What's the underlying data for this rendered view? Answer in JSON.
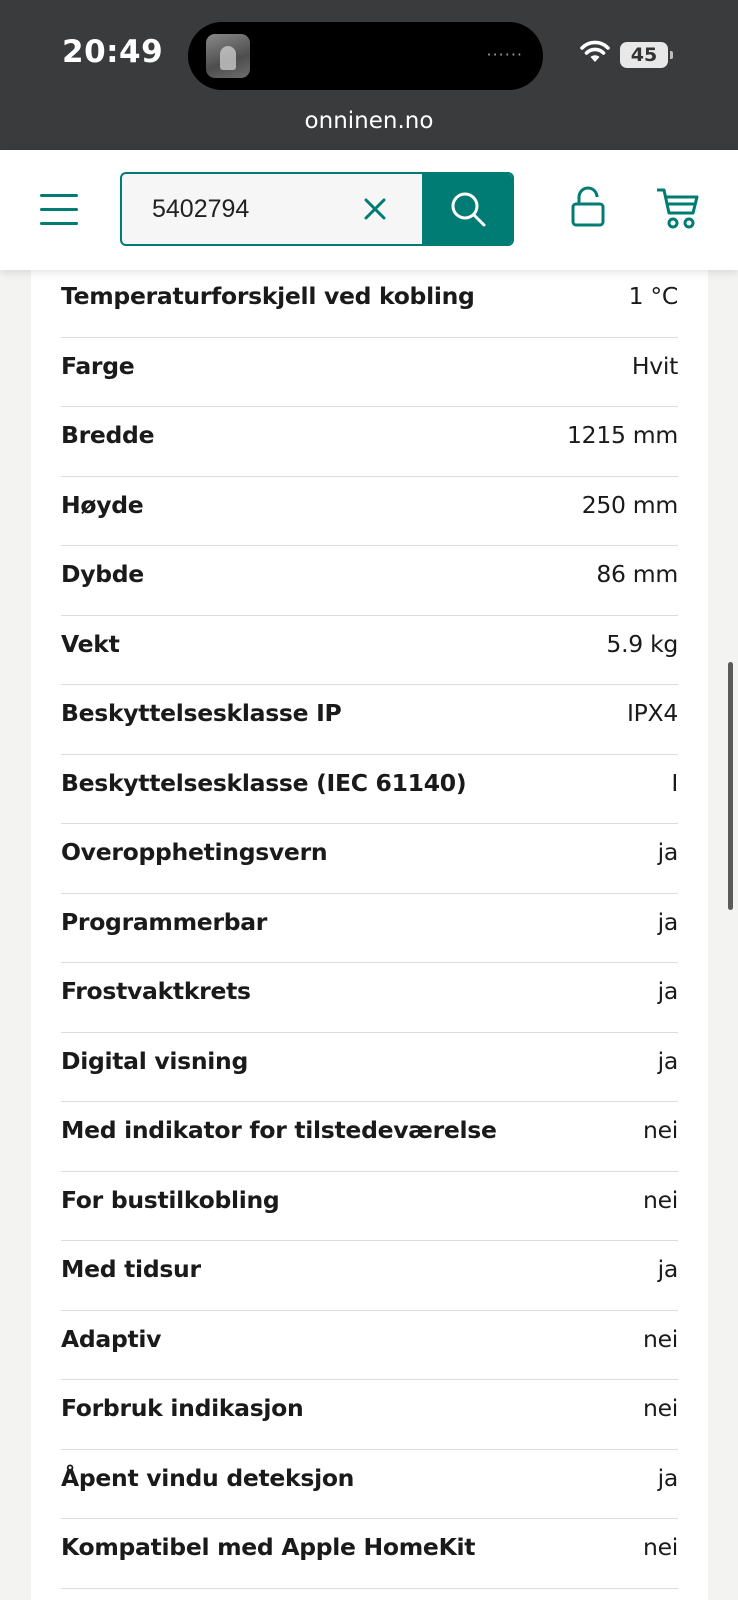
{
  "status_bar": {
    "time": "20:49",
    "battery": "45",
    "island_dots": "······"
  },
  "browser": {
    "url": "onninen.no"
  },
  "header": {
    "search_value": "5402794",
    "accent_color": "#007c74"
  },
  "specs": [
    {
      "label": "Temperaturforskjell ved kobling",
      "value": "1 °C"
    },
    {
      "label": "Farge",
      "value": "Hvit"
    },
    {
      "label": "Bredde",
      "value": "1215 mm"
    },
    {
      "label": "Høyde",
      "value": "250 mm"
    },
    {
      "label": "Dybde",
      "value": "86 mm"
    },
    {
      "label": "Vekt",
      "value": "5.9 kg"
    },
    {
      "label": "Beskyttelsesklasse IP",
      "value": "IPX4"
    },
    {
      "label": "Beskyttelsesklasse (IEC 61140)",
      "value": "I"
    },
    {
      "label": "Overopphetingsvern",
      "value": "ja"
    },
    {
      "label": "Programmerbar",
      "value": "ja"
    },
    {
      "label": "Frostvaktkrets",
      "value": "ja"
    },
    {
      "label": "Digital visning",
      "value": "ja"
    },
    {
      "label": "Med indikator for tilstedeværelse",
      "value": "nei"
    },
    {
      "label": "For bustilkobling",
      "value": "nei"
    },
    {
      "label": "Med tidsur",
      "value": "ja"
    },
    {
      "label": "Adaptiv",
      "value": "nei"
    },
    {
      "label": "Forbruk indikasjon",
      "value": "nei"
    },
    {
      "label": "Åpent vindu deteksjon",
      "value": "ja"
    },
    {
      "label": "Kompatibel med Apple HomeKit",
      "value": "nei"
    }
  ]
}
